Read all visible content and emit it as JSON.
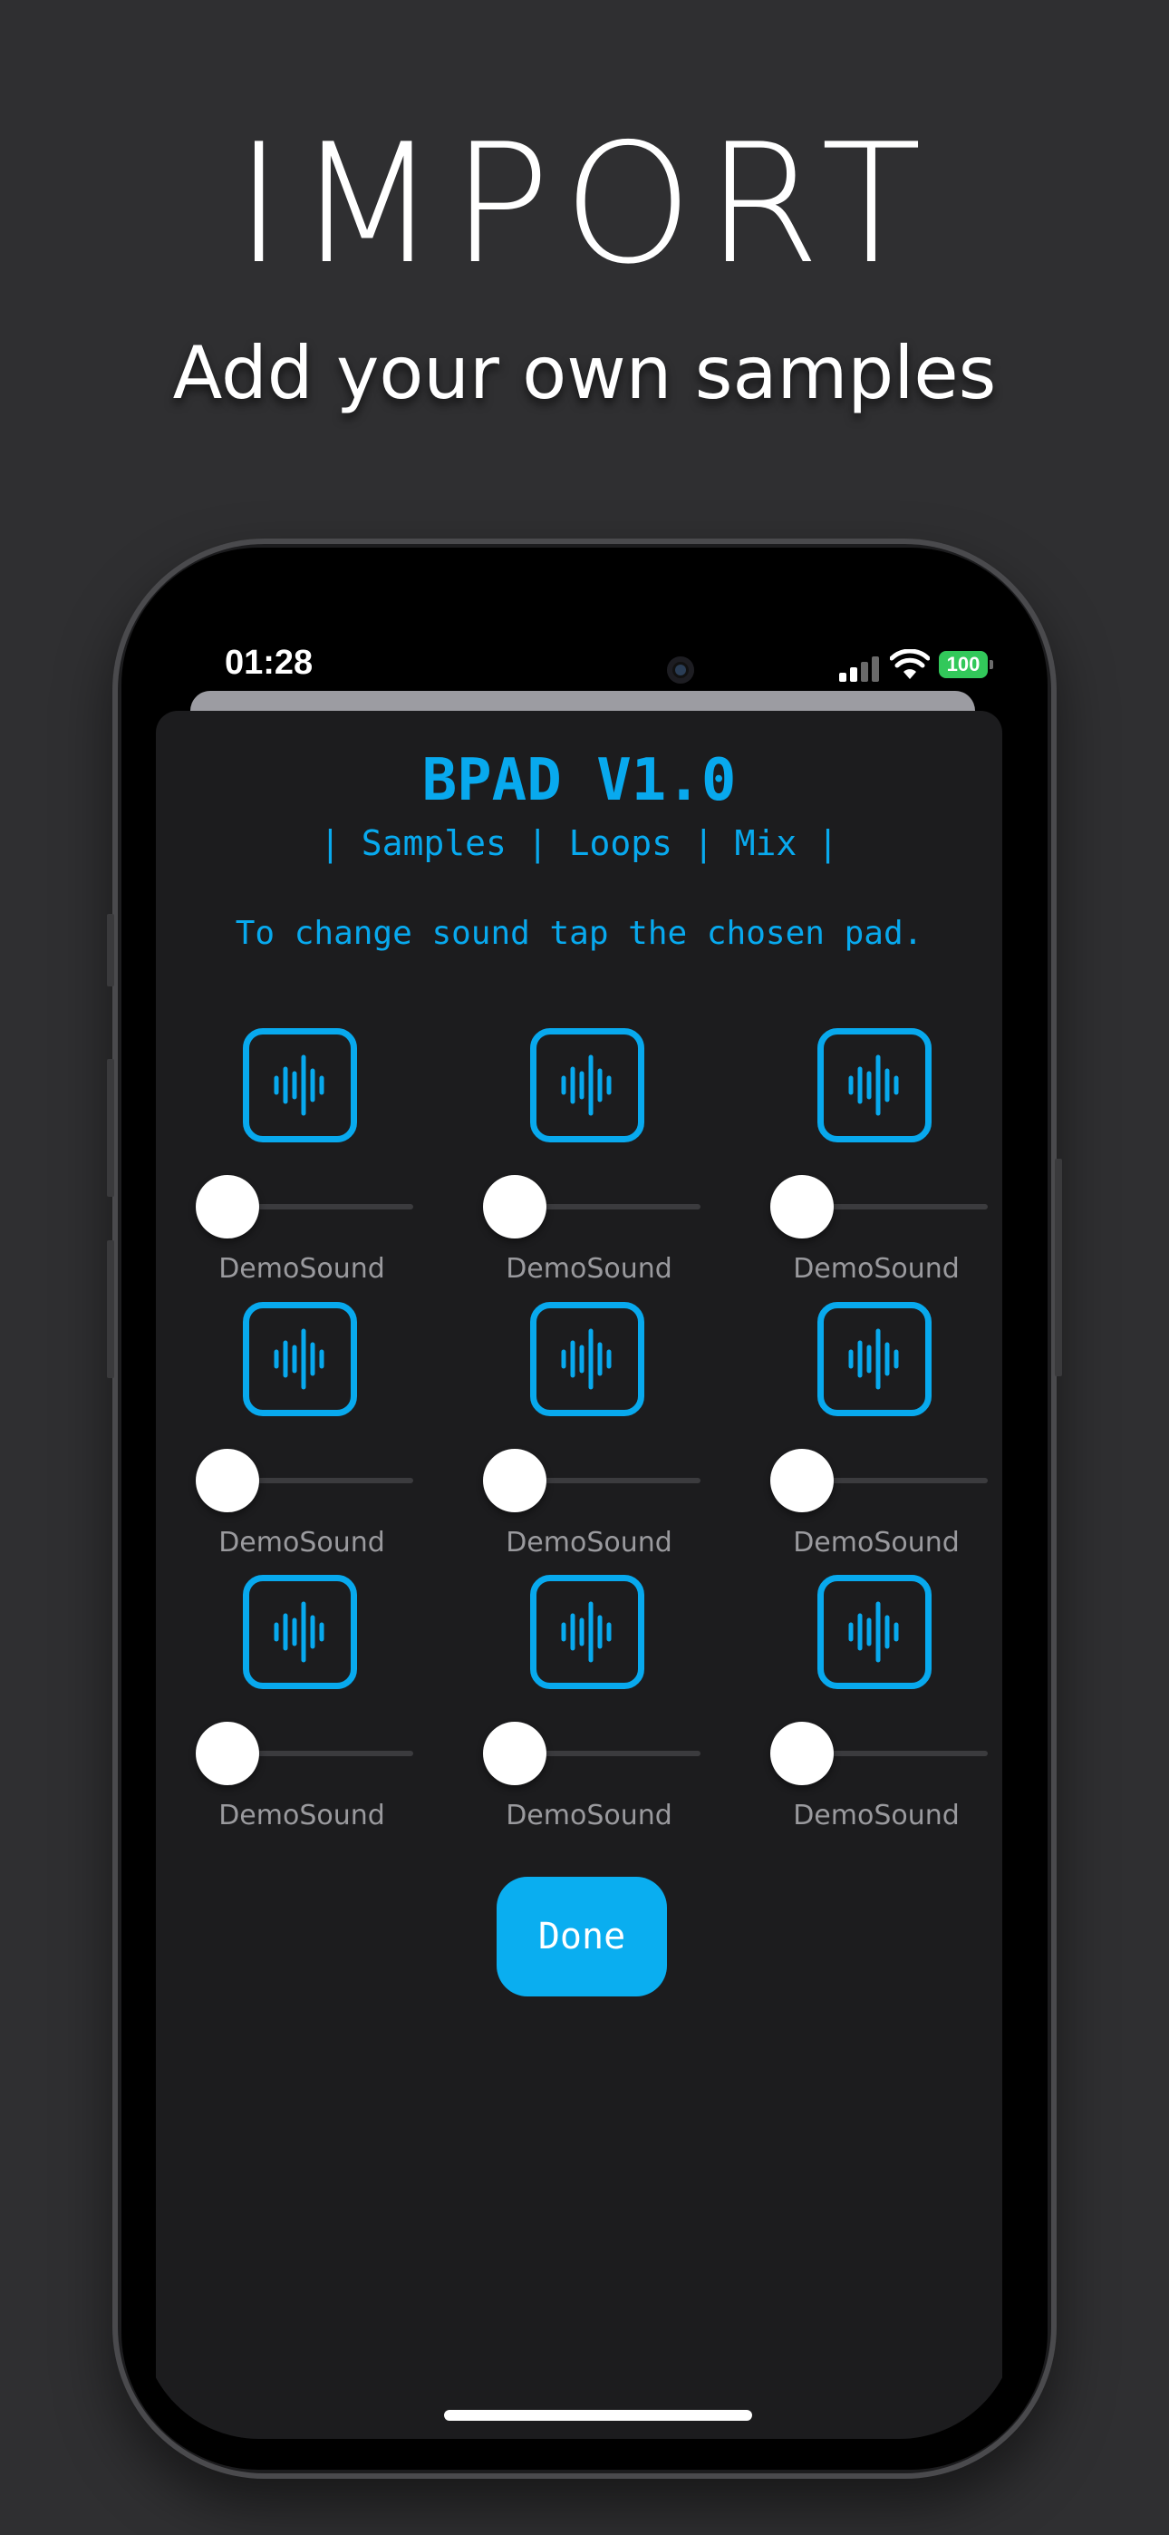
{
  "promo": {
    "headline": "IMPORT",
    "subline": "Add your own samples"
  },
  "status_bar": {
    "time": "01:28",
    "battery": "100"
  },
  "app": {
    "title": "BPAD V1.0",
    "nav": {
      "separator": "|",
      "samples": "Samples",
      "loops": "Loops",
      "mix": "Mix"
    },
    "hint": "To change sound tap the chosen pad.",
    "pads": [
      {
        "label": "DemoSound",
        "volume": 0
      },
      {
        "label": "DemoSound",
        "volume": 0
      },
      {
        "label": "DemoSound",
        "volume": 0
      },
      {
        "label": "DemoSound",
        "volume": 0
      },
      {
        "label": "DemoSound",
        "volume": 0
      },
      {
        "label": "DemoSound",
        "volume": 0
      },
      {
        "label": "DemoSound",
        "volume": 0
      },
      {
        "label": "DemoSound",
        "volume": 0
      },
      {
        "label": "DemoSound",
        "volume": 0
      }
    ],
    "pad_icon": "waveform-icon",
    "done_label": "Done"
  },
  "colors": {
    "accent": "#08a9ee",
    "background": "#2f2f31",
    "sheet": "#1c1c1e",
    "battery": "#32c85a"
  }
}
